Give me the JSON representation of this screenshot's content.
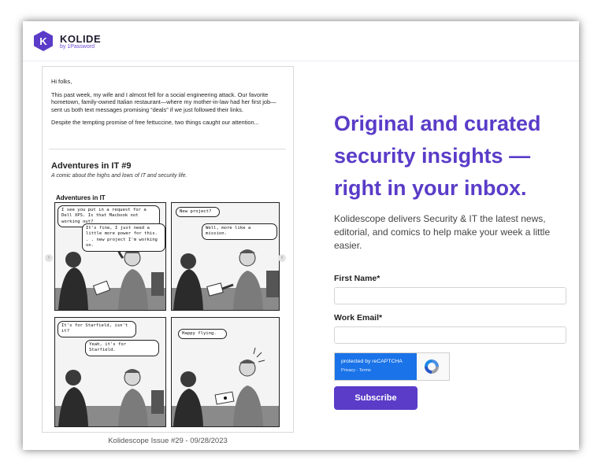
{
  "brand": {
    "name": "KOLIDE",
    "sub": "by 1Password",
    "logo_letter": "K",
    "accent_color": "#5a3cc8",
    "icon": "kolide-logo-icon"
  },
  "preview": {
    "greeting": "Hi folks,",
    "paragraph1": "This past week, my wife and I almost fell for a social engineering attack. Our favorite hometown, family-owned Italian restaurant—where my mother-in-law had her first job—sent us both text messages promising “deals” if we just followed their links.",
    "paragraph2": "Despite the tempting promise of free fettuccine, two things caught our attention...",
    "comic_title": "Adventures in IT #9",
    "comic_subtitle": "A comic about the highs and lows of IT and security life.",
    "comic_label": "Adventures in IT",
    "panels": [
      {
        "bubbles": [
          "I see you put in a request for a Dell XPS. Is that Macbook not working out?",
          "It's fine, I just need a little more power for this. . . new project I'm working on."
        ]
      },
      {
        "bubbles": [
          "New project?",
          "Well, more like a mission."
        ]
      },
      {
        "bubbles": [
          "It's for Starfield, isn't it?",
          "Yeah, it's for Starfield."
        ]
      },
      {
        "bubbles": [
          "Happy flying."
        ]
      }
    ],
    "prev_icon": "chevron-left-icon",
    "next_icon": "chevron-right-icon",
    "caption": "Kolidescope Issue #29 - 09/28/2023"
  },
  "signup": {
    "headline": "Original and curated security insights — right in your inbox.",
    "description": "Kolidescope delivers Security & IT the latest news, editorial, and comics to help make your week a little easier.",
    "first_name_label": "First Name*",
    "first_name_value": "",
    "work_email_label": "Work Email*",
    "work_email_value": "",
    "captcha_text": "protected by reCAPTCHA",
    "captcha_links": "Privacy - Terms",
    "captcha_icon": "recaptcha-icon",
    "subscribe_label": "Subscribe"
  }
}
